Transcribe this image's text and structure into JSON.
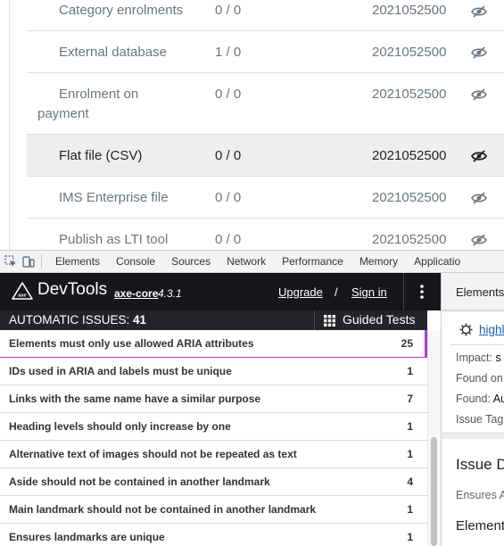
{
  "page_table": {
    "rows": [
      {
        "name": "Category enrolments",
        "count": "0 / 0",
        "date": "2021052500",
        "highlighted": false
      },
      {
        "name": "External database",
        "count": "1 / 0",
        "date": "2021052500",
        "highlighted": false
      },
      {
        "name_line1": "Enrolment on",
        "name_line2": "payment",
        "count": "0 / 0",
        "date": "2021052500",
        "highlighted": false
      },
      {
        "name": "Flat file (CSV)",
        "count": "0 / 0",
        "date": "2021052500",
        "highlighted": true
      },
      {
        "name": "IMS Enterprise file",
        "count": "0 / 0",
        "date": "2021052500",
        "highlighted": false
      },
      {
        "name": "Publish as LTI tool",
        "count": "0 / 0",
        "date": "2021052500",
        "highlighted": false
      }
    ],
    "icon": "eye-slash-icon"
  },
  "devtools_tabs": {
    "tabs": [
      "Elements",
      "Console",
      "Sources",
      "Network",
      "Performance",
      "Memory",
      "Applicatio"
    ]
  },
  "axe": {
    "title": "DevTools",
    "core_label": "axe-core",
    "version": "4.3.1",
    "upgrade": "Upgrade",
    "slash": "/",
    "signin": "Sign in",
    "issues_label": "AUTOMATIC ISSUES:",
    "issues_count": "41",
    "guided_tests": "Guided Tests",
    "issues": [
      {
        "label": "Elements must only use allowed ARIA attributes",
        "count": "25"
      },
      {
        "label": "IDs used in ARIA and labels must be unique",
        "count": "1"
      },
      {
        "label": "Links with the same name have a similar purpose",
        "count": "7"
      },
      {
        "label": "Heading levels should only increase by one",
        "count": "1"
      },
      {
        "label": "Alternative text of images should not be repeated as text",
        "count": "1"
      },
      {
        "label": "Aside should not be contained in another landmark",
        "count": "4"
      },
      {
        "label": "Main landmark should not be contained in another landmark",
        "count": "1"
      },
      {
        "label": "Ensures landmarks are unique",
        "count": "1"
      }
    ],
    "accent_color": "#a63ed1"
  },
  "detail_panel": {
    "tab": "Elements",
    "highlight": "highl",
    "impact_label": "Impact:",
    "impact_value": "s",
    "found_on_label": "Found on",
    "found_label": "Found:",
    "found_value": "Au",
    "issue_tags_label": "Issue Tag",
    "issue_heading": "Issue D",
    "ensures": "Ensures A",
    "element_heading": "Element"
  }
}
